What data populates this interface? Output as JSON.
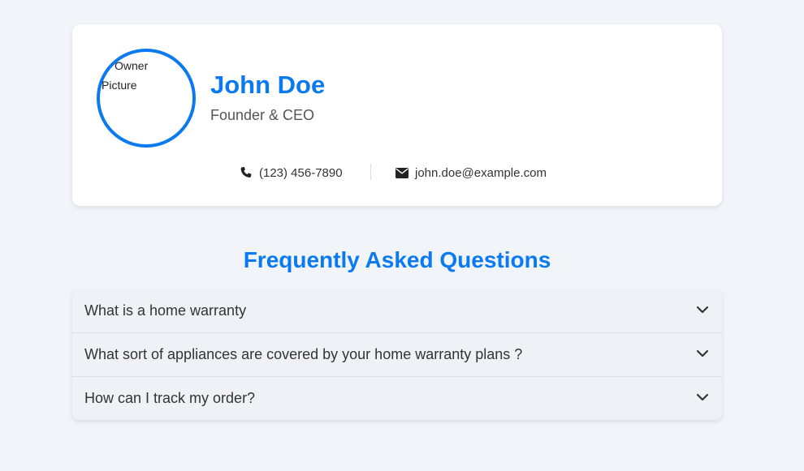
{
  "profile": {
    "avatar_alt": "Owner Picture",
    "name": "John Doe",
    "role": "Founder & CEO",
    "phone": "(123) 456-7890",
    "email": "john.doe@example.com",
    "phone_icon": "phone-icon",
    "email_icon": "envelope-icon"
  },
  "faq": {
    "title": "Frequently Asked Questions",
    "items": [
      {
        "question": "What is a home warranty",
        "icon": "chevron-down-icon"
      },
      {
        "question": "What sort of appliances are covered by your home warranty plans ?",
        "icon": "chevron-down-icon"
      },
      {
        "question": "How can I track my order?",
        "icon": "chevron-down-icon"
      }
    ]
  },
  "colors": {
    "accent": "#0b7af0",
    "background": "#f1f4f8",
    "card": "#ffffff",
    "faq_background": "#eef1f6"
  }
}
